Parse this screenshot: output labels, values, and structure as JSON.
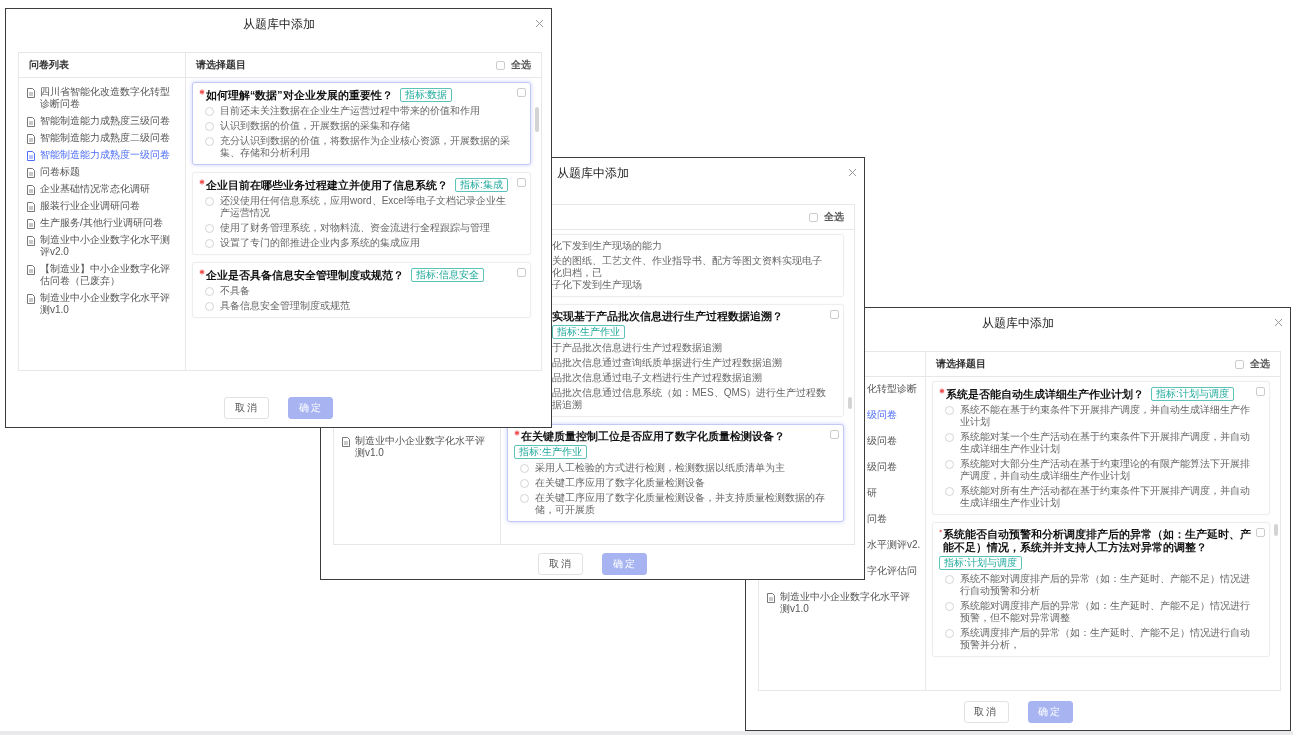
{
  "dialogs": [
    {
      "title": "从题库中添加",
      "list_header": "问卷列表",
      "questions_header": "请选择题目",
      "select_all": {
        "label": "全选",
        "checked": false
      },
      "questionnaires": [
        {
          "kind": "full",
          "name": "四川省智能化改造数字化转型诊断问卷",
          "selected": false
        },
        {
          "kind": "full",
          "name": "智能制造能力成熟度三级问卷",
          "selected": false
        },
        {
          "kind": "full",
          "name": "智能制造能力成熟度二级问卷",
          "selected": false
        },
        {
          "kind": "full",
          "name": "智能制造能力成熟度一级问卷",
          "selected": true
        },
        {
          "kind": "full",
          "name": "问卷标题",
          "selected": false
        },
        {
          "kind": "full",
          "name": "企业基础情况常态化调研",
          "selected": false
        },
        {
          "kind": "full",
          "name": "服装行业企业调研问卷",
          "selected": false
        },
        {
          "kind": "full",
          "name": "生产服务/其他行业调研问卷",
          "selected": false
        },
        {
          "kind": "full",
          "name": "制造业中小企业数字化水平测评v2.0",
          "selected": false
        },
        {
          "kind": "full",
          "name": "【制造业】中小企业数字化评估问卷（已废弃）",
          "selected": false
        },
        {
          "kind": "full",
          "name": "制造业中小企业数字化水平评测v1.0",
          "selected": false
        }
      ],
      "questions": [
        {
          "kind": "full",
          "required": true,
          "title": "如何理解“数据”对企业发展的重要性？",
          "tag": "指标:数据",
          "highlighted": true,
          "checked": false,
          "options": [
            {
              "text": "目前还未关注数据在企业生产运营过程中带来的价值和作用",
              "selected": false
            },
            {
              "text": "认识到数据的价值，开展数据的采集和存储",
              "selected": false
            },
            {
              "text": "充分认识到数据的价值，将数据作为企业核心资源，开展数据的采集、存储和分析利用",
              "selected": false
            }
          ]
        },
        {
          "kind": "full",
          "required": true,
          "title": "企业目前在哪些业务过程建立并使用了信息系统？",
          "tag": "指标:集成",
          "highlighted": false,
          "checked": false,
          "options": [
            {
              "text": "还没使用任何信息系统，应用word、Excel等电子文档记录企业生产运营情况",
              "selected": false
            },
            {
              "text": "使用了财务管理系统，对物料流、资金流进行全程跟踪与管理",
              "selected": false
            },
            {
              "text": "设置了专门的部推进企业内多系统的集成应用",
              "selected": false
            }
          ]
        },
        {
          "kind": "full",
          "required": true,
          "title": "企业是否具备信息安全管理制度或规范？",
          "tag": "指标:信息安全",
          "highlighted": false,
          "checked": false,
          "options": [
            {
              "text": "不具备",
              "selected": false
            },
            {
              "text": "具备信息安全管理制度或规范",
              "selected": false
            }
          ]
        }
      ],
      "buttons": [
        {
          "label": "取消",
          "kind": "cancel",
          "disabled": false
        },
        {
          "label": "确定",
          "kind": "confirm",
          "disabled": true
        }
      ]
    },
    {
      "title": "从题库中添加",
      "select_all": {
        "label": "全选",
        "checked": false
      },
      "questionnaires": [
        {
          "kind": "full",
          "name": "制造业中小企业数字化水平评测v1.0",
          "selected": false
        }
      ],
      "questions": [
        {
          "kind": "fragment",
          "highlighted": false,
          "options": [
            {
              "lines": [
                "化下发到生产现场的能力"
              ]
            },
            {
              "lines": [
                "关的图纸、工艺文件、作业指导书、配方等图文资料实现电子化归档，已",
                "子化下发到生产现场"
              ]
            }
          ]
        },
        {
          "kind": "fragment",
          "title": "实现基于产品批次信息进行生产过程数据追溯？",
          "tag": "指标:生产作业",
          "highlighted": false,
          "checked": false,
          "options": [
            {
              "lines": [
                "于产品批次信息进行生产过程数据追溯"
              ]
            },
            {
              "lines": [
                "品批次信息通过查询纸质单据进行生产过程数据追溯"
              ]
            },
            {
              "lines": [
                "品批次信息通过电子文档进行生产过程数据追溯"
              ]
            },
            {
              "lines": [
                "品批次信息通过信息系统（如：MES、QMS）进行生产过程数据追溯"
              ]
            }
          ]
        },
        {
          "kind": "full",
          "required": true,
          "title": "在关键质量控制工位是否应用了数字化质量检测设备？",
          "tag": "指标:生产作业",
          "highlighted": true,
          "checked": false,
          "options": [
            {
              "text": "采用人工检验的方式进行检测，检测数据以纸质清单为主",
              "selected": false
            },
            {
              "text": "在关键工序应用了数字化质量检测设备",
              "selected": false
            },
            {
              "text": "在关键工序应用了数字化质量检测设备，并支持质量检测数据的存储，可开展质",
              "selected": false
            }
          ]
        }
      ],
      "buttons": [
        {
          "label": "取消",
          "kind": "cancel",
          "disabled": false
        },
        {
          "label": "确定",
          "kind": "confirm",
          "disabled": true
        }
      ]
    },
    {
      "title": "从题库中添加",
      "questions_header": "请选择题目",
      "select_all": {
        "label": "全选",
        "checked": false
      },
      "questionnaires": [
        {
          "kind": "fragment",
          "name": "化转型诊断",
          "selected": false
        },
        {
          "kind": "fragment",
          "name": "级问卷",
          "selected": true
        },
        {
          "kind": "fragment",
          "name": "级问卷",
          "selected": false
        },
        {
          "kind": "fragment",
          "name": "级问卷",
          "selected": false
        },
        {
          "kind": "fragment",
          "name": "研",
          "selected": false
        },
        {
          "kind": "fragment",
          "name": "问卷",
          "selected": false
        },
        {
          "kind": "fragment",
          "name": "水平测评v2.",
          "selected": false
        },
        {
          "kind": "fragment",
          "name": "字化评估问",
          "selected": false
        },
        {
          "kind": "full",
          "name": "制造业中小企业数字化水平评测v1.0",
          "selected": false
        }
      ],
      "questions": [
        {
          "kind": "full",
          "required": true,
          "title": "系统是否能自动生成详细生产作业计划？",
          "tag": "指标:计划与调度",
          "highlighted": false,
          "checked": false,
          "options": [
            {
              "text": "系统不能在基于约束条件下开展排产调度，并自动生成详细生产作业计划",
              "selected": false
            },
            {
              "text": "系统能对某一个生产活动在基于约束条件下开展排产调度，并自动生成详细生产作业计划",
              "selected": false
            },
            {
              "text": "系统能对大部分生产活动在基于约束理论的有限产能算法下开展排产调度，并自动生成详细生产作业计划",
              "selected": false
            },
            {
              "text": "系统能对所有生产活动都在基于约束条件下开展排产调度，并自动生成详细生产作业计划",
              "selected": false
            }
          ]
        },
        {
          "kind": "full",
          "required": true,
          "title": "系统能否自动预警和分析调度排产后的异常（如：生产延时、产能不足）情况，系统并并支持人工方法对异常的调整？",
          "tag": "指标:计划与调度",
          "highlighted": false,
          "checked": false,
          "options": [
            {
              "text": "系统不能对调度排产后的异常（如：生产延时、产能不足）情况进行自动预警和分析",
              "selected": false
            },
            {
              "text": "系统能对调度排产后的异常（如：生产延时、产能不足）情况进行预警，但不能对异常调整",
              "selected": false
            },
            {
              "text": "系统调度排产后的异常（如：生产延时、产能不足）情况进行自动预警并分析，",
              "selected": false
            }
          ]
        }
      ],
      "buttons": [
        {
          "label": "取消",
          "kind": "cancel",
          "disabled": false
        },
        {
          "label": "确定",
          "kind": "confirm",
          "disabled": true
        }
      ]
    }
  ]
}
